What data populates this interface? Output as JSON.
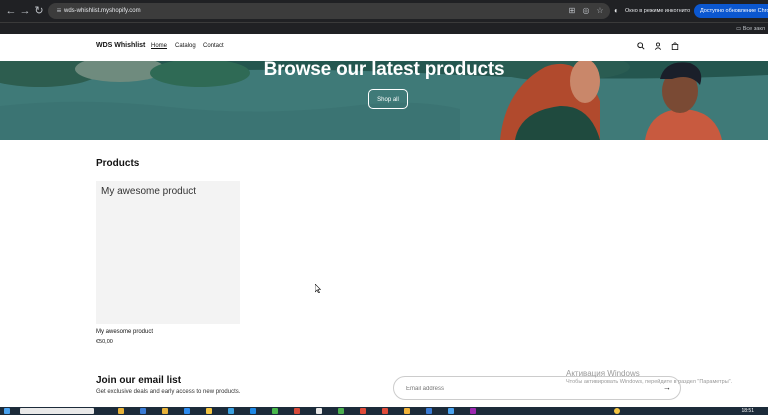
{
  "browser": {
    "url": "wds-whishlist.myshopify.com",
    "incognito_label": "Окно в режиме инкогнито",
    "update_label": "Доступно обновление Chrome",
    "bookmarks_label": "Все закл"
  },
  "header": {
    "brand": "WDS Whishlist",
    "menu": [
      "Home",
      "Catalog",
      "Contact"
    ]
  },
  "hero": {
    "title": "Browse our latest products",
    "button_label": "Shop all"
  },
  "products": {
    "title": "Products",
    "items": [
      {
        "image_text": "My awesome product",
        "title": "My awesome product",
        "price": "€50,00"
      }
    ]
  },
  "newsletter": {
    "title": "Join our email list",
    "text": "Get exclusive deals and early access to new products.",
    "placeholder": "Email address"
  },
  "watermark": {
    "title": "Активация Windows",
    "text": "Чтобы активировать Windows, перейдите в раздел \"Параметры\"."
  },
  "taskbar": {
    "clock": "18:51"
  },
  "colors": {
    "hero_bg": "#3f7a78",
    "chrome_bg": "#202124",
    "update_btn": "#0b57d0"
  }
}
